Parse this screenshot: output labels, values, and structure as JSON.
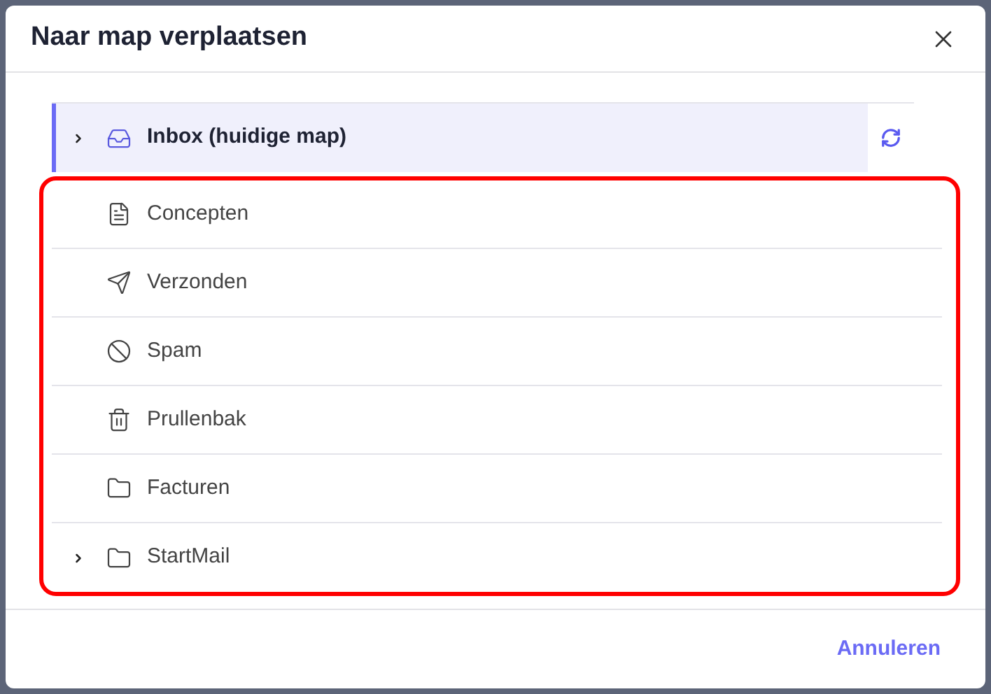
{
  "dialog": {
    "title": "Naar map verplaatsen"
  },
  "current_folder": {
    "label": "Inbox (huidige map)",
    "kind": "inbox",
    "has_children": true,
    "selected": true
  },
  "folders": [
    {
      "label": "Concepten",
      "kind": "document",
      "has_children": false,
      "selected": false
    },
    {
      "label": "Verzonden",
      "kind": "send",
      "has_children": false,
      "selected": false
    },
    {
      "label": "Spam",
      "kind": "ban",
      "has_children": false,
      "selected": false
    },
    {
      "label": "Prullenbak",
      "kind": "trash",
      "has_children": false,
      "selected": false
    },
    {
      "label": "Facturen",
      "kind": "folder",
      "has_children": false,
      "selected": false
    },
    {
      "label": "StartMail",
      "kind": "folder",
      "has_children": true,
      "selected": false
    }
  ],
  "buttons": [
    {
      "label": "Annuleren"
    }
  ]
}
